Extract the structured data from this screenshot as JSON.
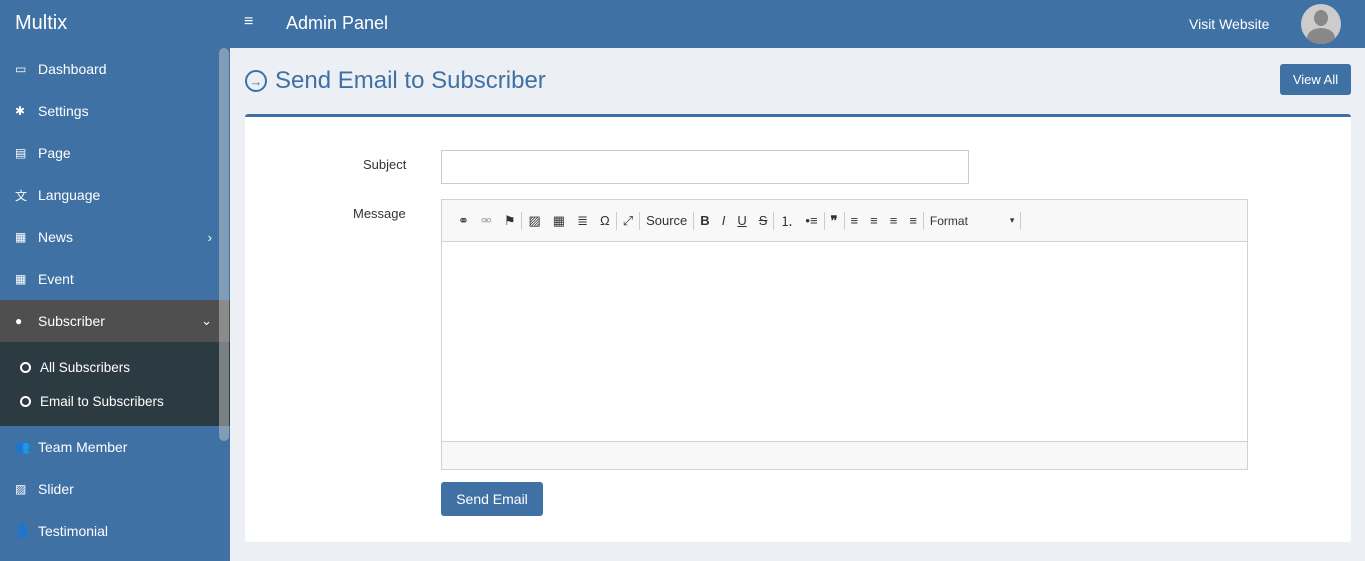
{
  "header": {
    "logo": "Multix",
    "menu_icon": "≡",
    "title": "Admin Panel",
    "visit": "Visit Website"
  },
  "sidebar": {
    "items": [
      {
        "label": "Dashboard",
        "icon": "▭"
      },
      {
        "label": "Settings",
        "icon": "✱"
      },
      {
        "label": "Page",
        "icon": "▤"
      },
      {
        "label": "Language",
        "icon": "文"
      },
      {
        "label": "News",
        "icon": "▦",
        "arrow": "›"
      },
      {
        "label": "Event",
        "icon": "▦"
      },
      {
        "label": "Subscriber",
        "icon": "●",
        "arrow": "⌄"
      },
      {
        "label": "Team Member",
        "icon": "👥"
      },
      {
        "label": "Slider",
        "icon": "▨"
      },
      {
        "label": "Testimonial",
        "icon": "👤"
      }
    ],
    "sub": [
      {
        "label": "All Subscribers"
      },
      {
        "label": "Email to Subscribers"
      }
    ]
  },
  "page": {
    "title": "Send Email to Subscriber",
    "view_all": "View All",
    "title_icon": "→"
  },
  "form": {
    "subject_label": "Subject",
    "subject_value": "",
    "message_label": "Message",
    "send": "Send Email",
    "toolbar": {
      "link": "⚭",
      "unlink": "⚮",
      "anchor": "⚑",
      "image": "▨",
      "table": "▦",
      "hr": "≣",
      "special": "Ω",
      "maximize": "⤢",
      "source": "Source",
      "bold": "B",
      "italic": "I",
      "underline": "U",
      "strike": "S",
      "ol": "⒈",
      "ul": "•≡",
      "quote": "❞",
      "left": "≡",
      "center": "≡",
      "right": "≡",
      "justify": "≡",
      "format": "Format",
      "caret": "▾"
    }
  }
}
